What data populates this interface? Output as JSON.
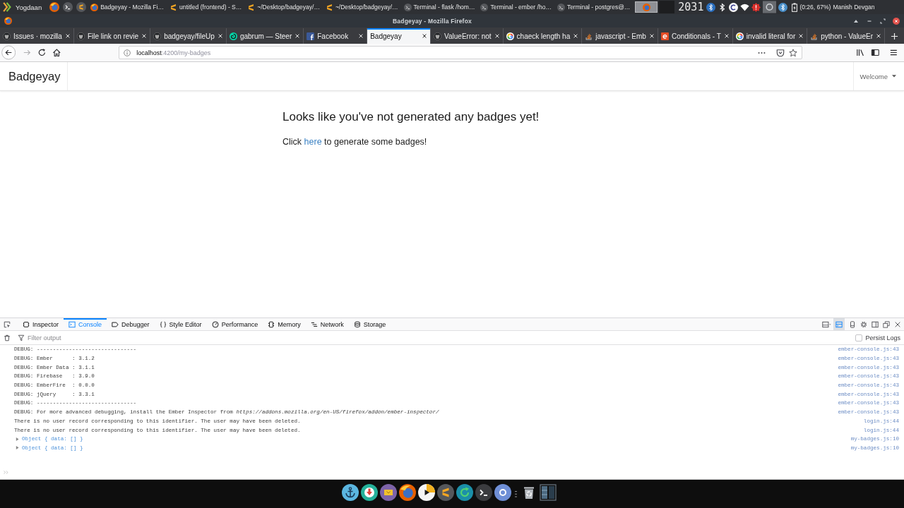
{
  "top_panel": {
    "menu_label": "Yogdaan",
    "tasks": [
      {
        "title": "Badgeyay - Mozilla Fi…",
        "kind": "browser"
      },
      {
        "title": "untitled (frontend) - S…",
        "kind": "editor"
      },
      {
        "title": "~/Desktop/badgeyay/…",
        "kind": "editor"
      },
      {
        "title": "~/Desktop/badgeyay/…",
        "kind": "editor"
      },
      {
        "title": "Terminal - flask /hom…",
        "kind": "terminal"
      },
      {
        "title": "Terminal - ember /ho…",
        "kind": "terminal"
      },
      {
        "title": "Terminal - postgres@…",
        "kind": "terminal"
      }
    ],
    "clock": "2031",
    "battery_status": "(0:26, 67%)",
    "user": "Manish Devgan"
  },
  "window": {
    "title": "Badgeyay - Mozilla Firefox"
  },
  "tabs": [
    {
      "title": "Issues · mozilla",
      "kind": "cat-circle",
      "selected": false
    },
    {
      "title": "File link on revie",
      "kind": "cat-circle",
      "selected": false
    },
    {
      "title": "badgeyay/fileUp",
      "kind": "cat-circle",
      "selected": false
    },
    {
      "title": "gabrum — Steer",
      "kind": "swirl",
      "selected": false
    },
    {
      "title": "Facebook",
      "kind": "bar-tile",
      "selected": false
    },
    {
      "title": "Badgeyay",
      "selected": true
    },
    {
      "title": "ValueError: not",
      "kind": "cat-circle",
      "selected": false
    },
    {
      "title": "chaeck length ha",
      "kind": "color-ring",
      "selected": false
    },
    {
      "title": "javascript - Emb",
      "kind": "stacked-lines",
      "selected": false
    },
    {
      "title": "Conditionals - T",
      "kind": "ring-tile",
      "selected": false
    },
    {
      "title": "invalid literal for",
      "kind": "color-ring",
      "selected": false
    },
    {
      "title": "python - ValueEr",
      "kind": "stacked-lines",
      "selected": false
    }
  ],
  "address_bar": {
    "host": "localhost",
    "path": ":4200/my-badges"
  },
  "page": {
    "brand": "Badgeyay",
    "user_menu": "Welcome",
    "heading": "Looks like you've not generated any badges yet!",
    "message": {
      "before": "Click",
      "link": "here",
      "after": "to generate some badges!"
    }
  },
  "devtools": {
    "tabs": [
      {
        "label": "Inspector",
        "kind": "inspector",
        "selected": false
      },
      {
        "label": "Console",
        "kind": "console",
        "selected": true
      },
      {
        "label": "Debugger",
        "kind": "debugger",
        "selected": false
      },
      {
        "label": "Style Editor",
        "kind": "style-editor",
        "selected": false
      },
      {
        "label": "Performance",
        "kind": "performance",
        "selected": false
      },
      {
        "label": "Memory",
        "kind": "memory",
        "selected": false
      },
      {
        "label": "Network",
        "kind": "network",
        "selected": false
      },
      {
        "label": "Storage",
        "kind": "storage",
        "selected": false
      }
    ],
    "split_console": {
      "on": true
    },
    "filter": {
      "placeholder": "Filter output"
    },
    "persist_logs": {
      "label": "Persist Logs",
      "checked": false
    },
    "messages": [
      {
        "kind": "log",
        "text": "DEBUG: -------------------------------",
        "source": "ember-console.js:43"
      },
      {
        "kind": "log",
        "text": "DEBUG: Ember      : 3.1.2",
        "source": "ember-console.js:43"
      },
      {
        "kind": "log",
        "text": "DEBUG: Ember Data : 3.1.1",
        "source": "ember-console.js:43"
      },
      {
        "kind": "log",
        "text": "DEBUG: Firebase   : 3.9.0",
        "source": "ember-console.js:43"
      },
      {
        "kind": "log",
        "text": "DEBUG: EmberFire  : 0.0.0",
        "source": "ember-console.js:43"
      },
      {
        "kind": "log",
        "text": "DEBUG: jQuery     : 3.3.1",
        "source": "ember-console.js:43"
      },
      {
        "kind": "log",
        "text": "DEBUG: -------------------------------",
        "source": "ember-console.js:43"
      },
      {
        "kind": "log",
        "text": "DEBUG: For more advanced debugging, install the Ember Inspector from *https://addons.mozilla.org/en-US/firefox/addon/ember-inspector/*",
        "source": "ember-console.js:43"
      },
      {
        "kind": "log",
        "text": "There is no user record corresponding to this identifier. The user may have been deleted.",
        "source": "login.js:44"
      },
      {
        "kind": "log",
        "text": "There is no user record corresponding to this identifier. The user may have been deleted.",
        "source": "login.js:44"
      },
      {
        "kind": "object",
        "text": "Object { data: [] }",
        "expanded": false,
        "source": "my-badges.js:10"
      },
      {
        "kind": "object",
        "text": "Object { data: [] }",
        "expanded": false,
        "source": "my-badges.js:10"
      }
    ]
  }
}
